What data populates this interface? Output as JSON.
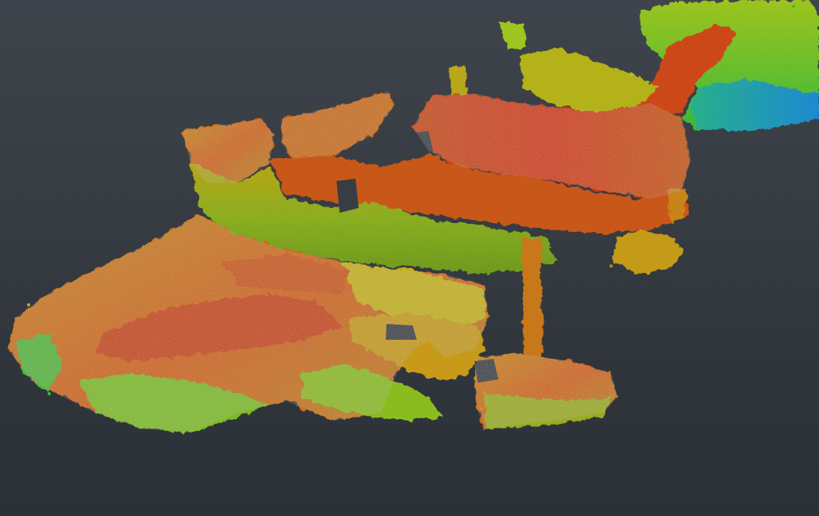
{
  "viewer": {
    "view": "3d-perspective",
    "object": "point-cloud-scan",
    "colour_scale": [
      "#1f6fd0",
      "#18b89c",
      "#3cc23a",
      "#9ccc1e",
      "#d8c21a",
      "#e08a16",
      "#d8461a",
      "#c22a14"
    ],
    "background_colors": {
      "top": "#3f444c",
      "bottom": "#2c3138"
    }
  }
}
